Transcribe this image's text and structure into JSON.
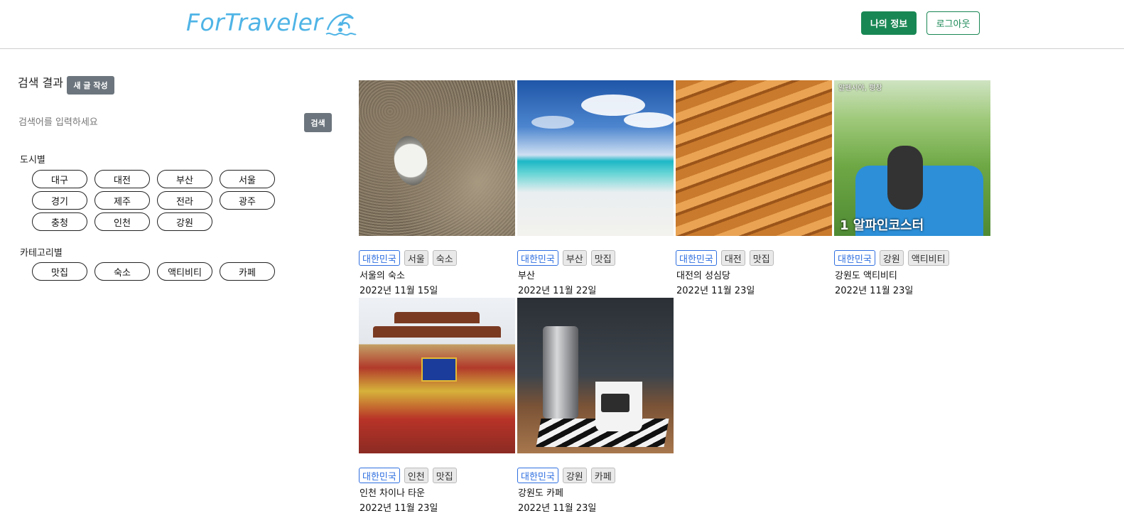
{
  "header": {
    "logo_text": "ForTraveler",
    "my_info_label": "나의 정보",
    "logout_label": "로그아웃",
    "colors": {
      "brand": "#4fb4e6",
      "primary": "#198754"
    }
  },
  "sidebar": {
    "title": "검색 결과",
    "new_post_label": "새 글 작성",
    "search": {
      "placeholder": "검색어를 입력하세요",
      "value": "",
      "button_label": "검색"
    },
    "city_section_label": "도시별",
    "cities": [
      "대구",
      "대전",
      "부산",
      "서울",
      "경기",
      "제주",
      "전라",
      "광주",
      "충청",
      "인천",
      "강원"
    ],
    "category_section_label": "카테고리별",
    "categories": [
      "맛집",
      "숙소",
      "액티비티",
      "카페"
    ]
  },
  "posts": [
    {
      "image": "pocket-watch",
      "tags": [
        "대한민국",
        "서울",
        "숙소"
      ],
      "title": "서울의 숙소",
      "date": "2022년 11월 15일"
    },
    {
      "image": "beach",
      "tags": [
        "대한민국",
        "부산",
        "맛집"
      ],
      "title": "부산",
      "date": "2022년 11월 22일"
    },
    {
      "image": "bakery",
      "tags": [
        "대한민국",
        "대전",
        "맛집"
      ],
      "title": "대전의 성심당",
      "date": "2022년 11월 23일"
    },
    {
      "image": "alpine-coaster",
      "tags": [
        "대한민국",
        "강원",
        "액티비티"
      ],
      "title": "강원도 액티비티",
      "date": "2022년 11월 23일",
      "image_caption": "1 알파인코스터",
      "image_top_text": "알펜시아, 평창"
    },
    {
      "image": "chinatown-gate",
      "tags": [
        "대한민국",
        "인천",
        "맛집"
      ],
      "title": "인천 차이나 타운",
      "date": "2022년 11월 23일"
    },
    {
      "image": "coffee",
      "tags": [
        "대한민국",
        "강원",
        "카페"
      ],
      "title": "강원도 카페",
      "date": "2022년 11월 23일"
    }
  ]
}
